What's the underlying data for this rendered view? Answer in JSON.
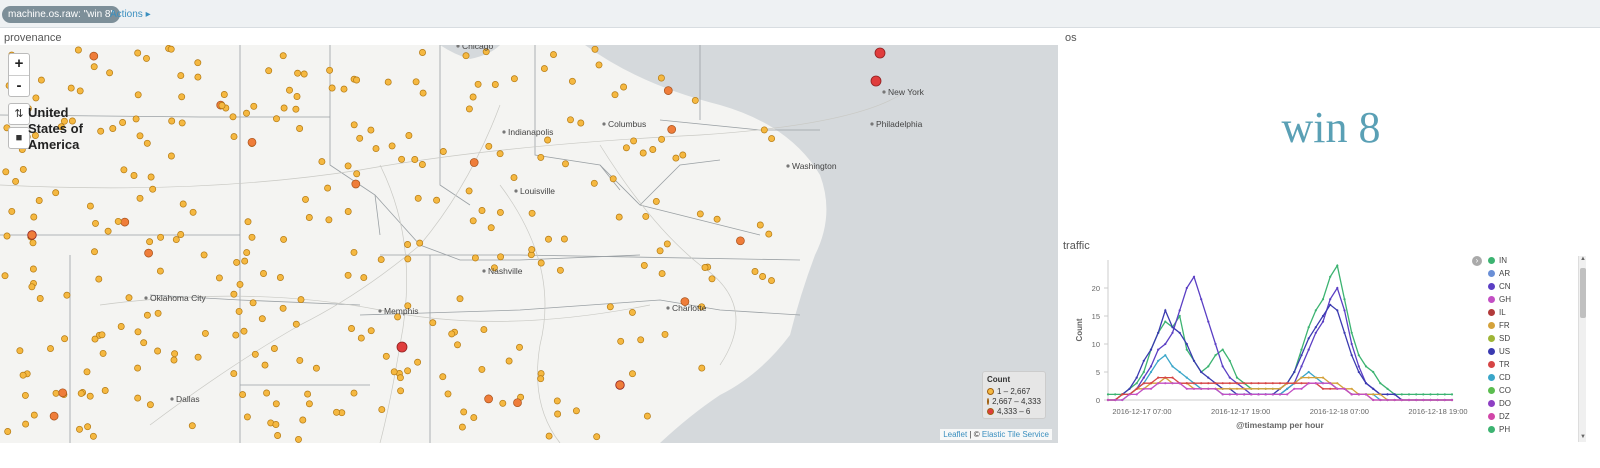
{
  "filter": {
    "pill": "machine.os.raw: \"win 8\"",
    "actions": "Actions ▸"
  },
  "map_panel": {
    "title": "provenance",
    "zoom_in": "+",
    "zoom_out": "-",
    "country": "United States of America",
    "cities": [
      {
        "name": "Chicago"
      },
      {
        "name": "Indianapolis"
      },
      {
        "name": "Columbus"
      },
      {
        "name": "New York"
      },
      {
        "name": "Philadelphia"
      },
      {
        "name": "Washington"
      },
      {
        "name": "Louisville"
      },
      {
        "name": "Nashville"
      },
      {
        "name": "Oklahoma City"
      },
      {
        "name": "Memphis"
      },
      {
        "name": "Charlotte"
      },
      {
        "name": "Dallas"
      }
    ],
    "legend": {
      "title": "Count",
      "items": [
        {
          "label": "1 – 2,667",
          "color": "#f5b841"
        },
        {
          "label": "2,667 – 4,333",
          "color": "#ef7d3a"
        },
        {
          "label": "4,333 – 6",
          "color": "#e03d3d"
        }
      ]
    },
    "attribution": {
      "leaflet": "Leaflet",
      "sep": " | © ",
      "service": "Elastic Tile Service"
    }
  },
  "os_panel": {
    "title": "os",
    "value": "win 8"
  },
  "traffic_panel": {
    "title": "traffic",
    "legend": [
      {
        "code": "IN",
        "color": "#3cb371"
      },
      {
        "code": "AR",
        "color": "#6a8fd6"
      },
      {
        "code": "CN",
        "color": "#5b3fc4"
      },
      {
        "code": "GH",
        "color": "#c34fc4"
      },
      {
        "code": "IL",
        "color": "#b23a3a"
      },
      {
        "code": "FR",
        "color": "#d4a23b"
      },
      {
        "code": "SD",
        "color": "#9fb536"
      },
      {
        "code": "US",
        "color": "#3a3ab0"
      },
      {
        "code": "TR",
        "color": "#d64545"
      },
      {
        "code": "CD",
        "color": "#3aa6c9"
      },
      {
        "code": "CO",
        "color": "#5bbd4f"
      },
      {
        "code": "DO",
        "color": "#8e3fc4"
      },
      {
        "code": "DZ",
        "color": "#d146a8"
      },
      {
        "code": "PH",
        "color": "#3cb371"
      }
    ]
  },
  "chart_data": {
    "type": "line",
    "title": "traffic",
    "xlabel": "@timestamp per hour",
    "ylabel": "Count",
    "ylim": [
      0,
      25
    ],
    "yticks": [
      0,
      5,
      10,
      15,
      20
    ],
    "xticks": [
      "2016-12-17 07:00",
      "2016-12-17 19:00",
      "2016-12-18 07:00",
      "2016-12-18 19:00"
    ],
    "x": [
      0,
      1,
      2,
      3,
      4,
      5,
      6,
      7,
      8,
      9,
      10,
      11,
      12,
      13,
      14,
      15,
      16,
      17,
      18,
      19,
      20,
      21,
      22,
      23,
      24,
      25,
      26,
      27,
      28,
      29,
      30,
      31,
      32,
      33,
      34,
      35,
      36,
      37,
      38,
      39,
      40,
      41,
      42,
      43,
      44,
      45,
      46,
      47,
      48
    ],
    "grid": false,
    "legend": "right",
    "series": [
      {
        "name": "IN",
        "values": [
          1,
          1,
          1,
          2,
          3,
          5,
          9,
          12,
          14,
          13,
          15,
          9,
          7,
          5,
          6,
          8,
          9,
          7,
          4,
          3,
          2,
          2,
          2,
          2,
          2,
          3,
          5,
          9,
          13,
          16,
          18,
          22,
          24,
          18,
          12,
          8,
          6,
          5,
          3,
          2,
          1,
          1,
          1,
          1,
          1,
          1,
          1,
          1,
          1
        ]
      },
      {
        "name": "CN",
        "values": [
          0,
          0,
          1,
          1,
          2,
          4,
          6,
          9,
          10,
          12,
          16,
          20,
          22,
          18,
          14,
          10,
          6,
          4,
          3,
          2,
          1,
          1,
          1,
          1,
          1,
          2,
          3,
          6,
          9,
          12,
          14,
          18,
          20,
          16,
          10,
          6,
          3,
          2,
          1,
          1,
          1,
          0,
          0,
          0,
          0,
          0,
          0,
          0,
          0
        ]
      },
      {
        "name": "US",
        "values": [
          0,
          0,
          1,
          2,
          4,
          7,
          9,
          12,
          16,
          13,
          12,
          10,
          7,
          5,
          4,
          3,
          2,
          2,
          1,
          1,
          1,
          1,
          1,
          1,
          2,
          3,
          5,
          8,
          11,
          13,
          15,
          17,
          16,
          12,
          8,
          5,
          3,
          2,
          1,
          1,
          1,
          0,
          0,
          0,
          0,
          0,
          0,
          0,
          0
        ]
      },
      {
        "name": "CD",
        "values": [
          0,
          0,
          0,
          1,
          2,
          3,
          5,
          7,
          8,
          6,
          5,
          4,
          3,
          2,
          2,
          2,
          1,
          1,
          1,
          1,
          1,
          1,
          1,
          1,
          1,
          2,
          3,
          4,
          5,
          4,
          3,
          3,
          2,
          2,
          1,
          1,
          1,
          1,
          0,
          0,
          0,
          0,
          0,
          0,
          0,
          0,
          0,
          0,
          0
        ]
      },
      {
        "name": "FR",
        "values": [
          0,
          0,
          1,
          1,
          2,
          2,
          3,
          3,
          4,
          3,
          3,
          3,
          2,
          2,
          2,
          2,
          2,
          2,
          2,
          2,
          2,
          2,
          2,
          2,
          2,
          3,
          3,
          4,
          4,
          4,
          4,
          3,
          3,
          2,
          2,
          1,
          1,
          1,
          1,
          0,
          0,
          0,
          0,
          0,
          0,
          0,
          0,
          0,
          0
        ]
      },
      {
        "name": "TR",
        "values": [
          0,
          0,
          1,
          1,
          2,
          3,
          3,
          4,
          4,
          4,
          3,
          3,
          3,
          3,
          3,
          3,
          3,
          3,
          3,
          3,
          3,
          3,
          3,
          3,
          3,
          3,
          3,
          3,
          3,
          3,
          2,
          2,
          2,
          2,
          1,
          1,
          1,
          0,
          0,
          0,
          0,
          0,
          0,
          0,
          0,
          0,
          0,
          0,
          0
        ]
      },
      {
        "name": "GH",
        "values": [
          0,
          0,
          0,
          1,
          1,
          2,
          2,
          3,
          3,
          3,
          3,
          2,
          2,
          2,
          2,
          2,
          1,
          1,
          1,
          1,
          1,
          1,
          1,
          1,
          1,
          1,
          2,
          2,
          3,
          3,
          3,
          3,
          2,
          2,
          1,
          1,
          1,
          0,
          0,
          0,
          0,
          0,
          0,
          0,
          0,
          0,
          0,
          0,
          0
        ]
      }
    ]
  }
}
